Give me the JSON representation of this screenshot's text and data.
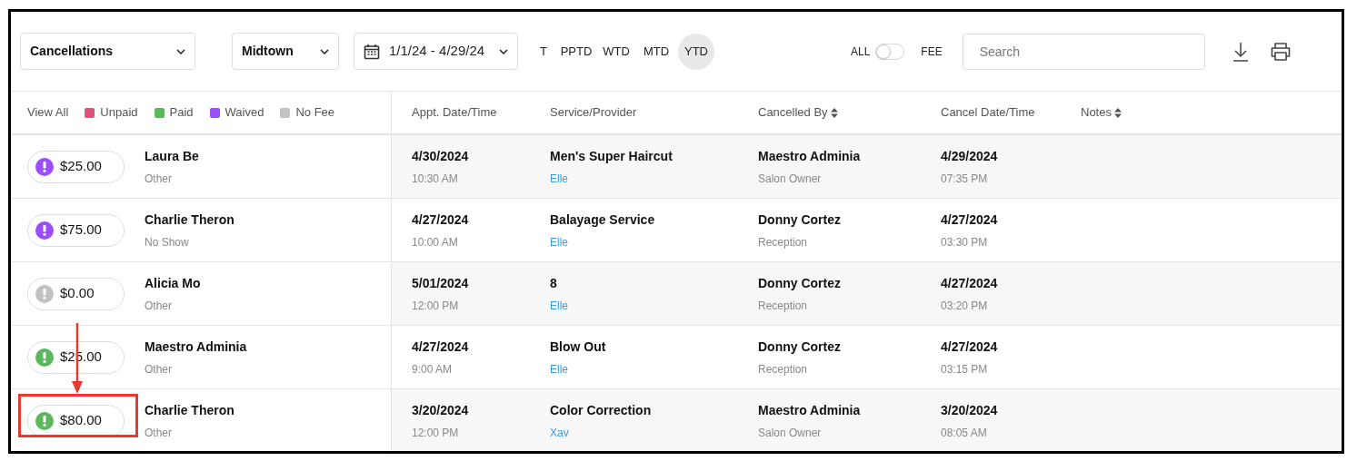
{
  "toolbar": {
    "report_select": "Cancellations",
    "location_select": "Midtown",
    "date_range": "1/1/24 - 4/29/24",
    "periods": [
      {
        "label": "T",
        "selected": false
      },
      {
        "label": "PPTD",
        "selected": false
      },
      {
        "label": "WTD",
        "selected": false
      },
      {
        "label": "MTD",
        "selected": false
      },
      {
        "label": "YTD",
        "selected": true
      }
    ],
    "fee_toggle": {
      "left_label": "ALL",
      "right_label": "FEE",
      "on": false
    },
    "search": {
      "placeholder": "Search"
    }
  },
  "legend": {
    "view_all": "View All",
    "items": [
      {
        "label": "Unpaid",
        "color": "#e0507a"
      },
      {
        "label": "Paid",
        "color": "#5cb85c"
      },
      {
        "label": "Waived",
        "color": "#9b4dff"
      },
      {
        "label": "No Fee",
        "color": "#c2c2c4"
      }
    ]
  },
  "table": {
    "columns": [
      {
        "label": "Appt. Date/Time",
        "sortable": false
      },
      {
        "label": "Service/Provider",
        "sortable": false
      },
      {
        "label": "Cancelled By",
        "sortable": true
      },
      {
        "label": "Cancel Date/Time",
        "sortable": false
      },
      {
        "label": "Notes",
        "sortable": true
      }
    ],
    "rows": [
      {
        "amount": "$25.00",
        "color": "#9b4dff",
        "client": "Laura Be",
        "reason": "Other",
        "appt_date": "4/30/2024",
        "appt_time": "10:30 AM",
        "service": "Men's Super Haircut",
        "provider": "Elle",
        "cancelled_by": "Maestro Adminia",
        "role": "Salon Owner",
        "cancel_date": "4/29/2024",
        "cancel_time": "07:35 PM",
        "highlighted": false
      },
      {
        "amount": "$75.00",
        "color": "#9b4dff",
        "client": "Charlie Theron",
        "reason": "No Show",
        "appt_date": "4/27/2024",
        "appt_time": "10:00 AM",
        "service": "Balayage Service",
        "provider": "Elle",
        "cancelled_by": "Donny Cortez",
        "role": "Reception",
        "cancel_date": "4/27/2024",
        "cancel_time": "03:30 PM",
        "highlighted": false
      },
      {
        "amount": "$0.00",
        "color": "#c2c2c4",
        "client": "Alicia Mo",
        "reason": "Other",
        "appt_date": "5/01/2024",
        "appt_time": "12:00 PM",
        "service": "8",
        "provider": "Elle",
        "cancelled_by": "Donny Cortez",
        "role": "Reception",
        "cancel_date": "4/27/2024",
        "cancel_time": "03:20 PM",
        "highlighted": false
      },
      {
        "amount": "$25.00",
        "color": "#5cb85c",
        "client": "Maestro Adminia",
        "reason": "Other",
        "appt_date": "4/27/2024",
        "appt_time": "9:00 AM",
        "service": "Blow Out",
        "provider": "Elle",
        "cancelled_by": "Donny Cortez",
        "role": "Reception",
        "cancel_date": "4/27/2024",
        "cancel_time": "03:15 PM",
        "highlighted": false
      },
      {
        "amount": "$80.00",
        "color": "#5cb85c",
        "client": "Charlie Theron",
        "reason": "Other",
        "appt_date": "3/20/2024",
        "appt_time": "12:00 PM",
        "service": "Color Correction",
        "provider": "Xav",
        "cancelled_by": "Maestro Adminia",
        "role": "Salon Owner",
        "cancel_date": "3/20/2024",
        "cancel_time": "08:05 AM",
        "highlighted": true
      }
    ]
  }
}
